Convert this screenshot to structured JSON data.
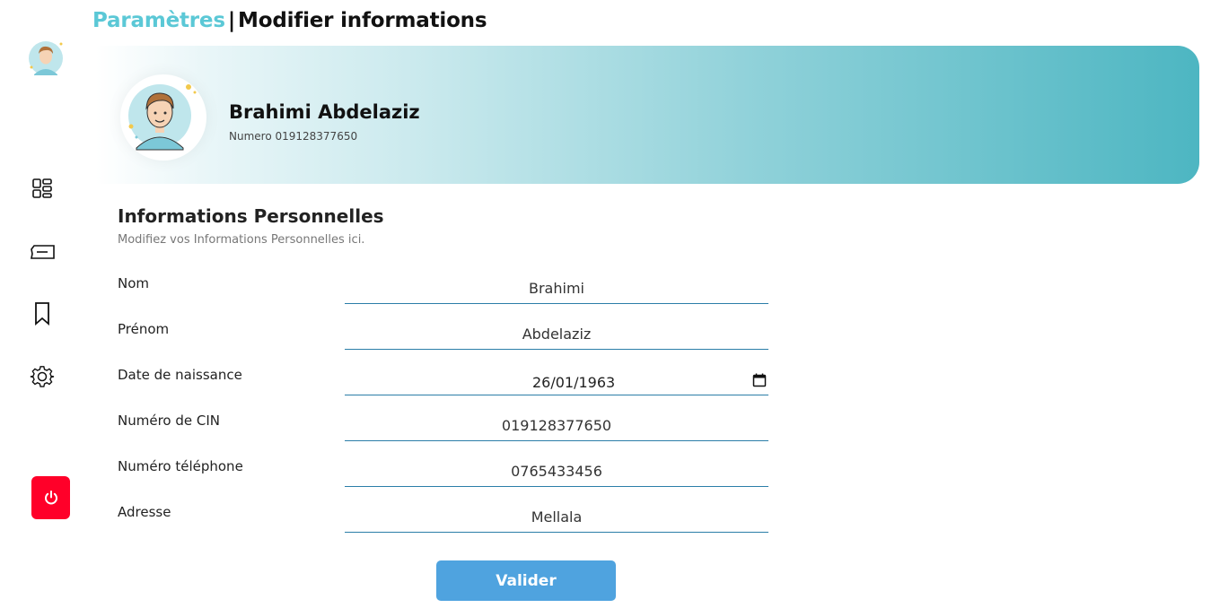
{
  "header": {
    "breadcrumb": "Paramètres",
    "separator": "|",
    "current": "Modifier informations",
    "accent_color": "#5bc8d6"
  },
  "sidebar": {
    "items": [
      {
        "name": "dashboard",
        "icon": "grid-icon"
      },
      {
        "name": "tickets",
        "icon": "ticket-icon"
      },
      {
        "name": "bookmarks",
        "icon": "bookmark-icon"
      },
      {
        "name": "settings",
        "icon": "gear-icon"
      }
    ],
    "logout_icon": "power-icon",
    "logout_color": "#ff0029"
  },
  "profile": {
    "name": "Brahimi Abdelaziz",
    "numero_label": "Numero 019128377650"
  },
  "form": {
    "title": "Informations Personnelles",
    "subtitle": "Modifiez vos Informations Personnelles ici.",
    "fields": {
      "nom": {
        "label": "Nom",
        "value": "Brahimi"
      },
      "prenom": {
        "label": "Prénom",
        "value": "Abdelaziz"
      },
      "date": {
        "label": "Date de naissance",
        "value": "26/01/1963"
      },
      "cin": {
        "label": "Numéro de CIN",
        "value": "019128377650"
      },
      "telephone": {
        "label": "Numéro téléphone",
        "value": "0765433456"
      },
      "adresse": {
        "label": "Adresse",
        "value": "Mellala"
      }
    },
    "submit_label": "Valider",
    "submit_color": "#4fa3df"
  }
}
